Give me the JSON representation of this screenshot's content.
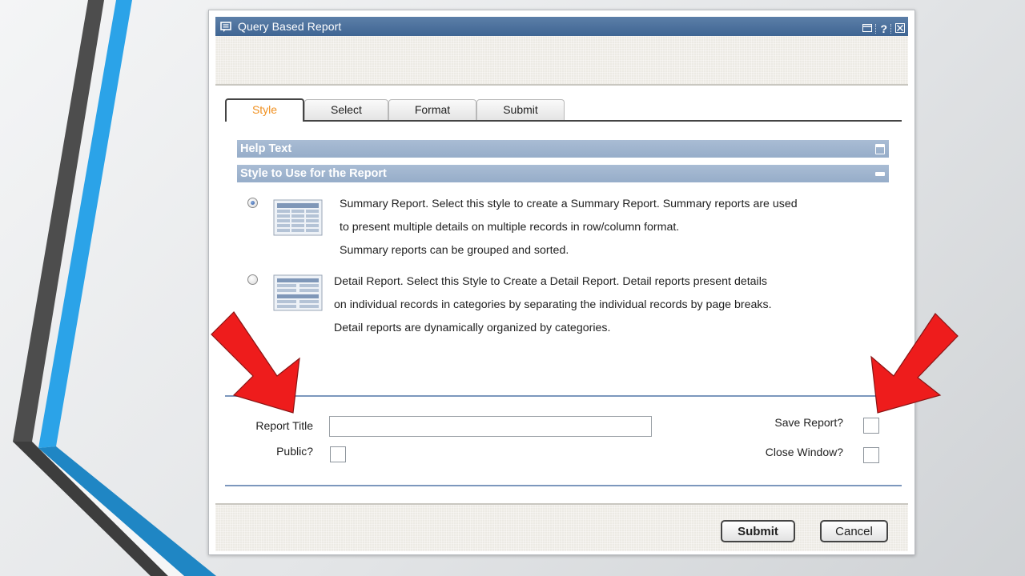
{
  "window": {
    "title": "Query Based Report",
    "help_glyph": "?"
  },
  "tabs": [
    {
      "label": "Style",
      "active": true
    },
    {
      "label": "Select",
      "active": false
    },
    {
      "label": "Format",
      "active": false
    },
    {
      "label": "Submit",
      "active": false
    }
  ],
  "sections": {
    "help_text": "Help Text",
    "style_to_use": "Style to Use for the Report"
  },
  "styles": [
    {
      "selected": true,
      "icon": "summary-report-icon",
      "lines": [
        "Summary Report. Select this style to create a Summary Report. Summary reports are used",
        "to present multiple details on multiple records in row/column format.",
        "Summary reports can be grouped and sorted."
      ]
    },
    {
      "selected": false,
      "icon": "detail-report-icon",
      "lines": [
        "Detail Report. Select this Style to Create a Detail Report. Detail reports present details",
        "on individual records in categories by separating the individual records by page breaks.",
        "Detail reports are dynamically organized by categories."
      ]
    }
  ],
  "form": {
    "report_title_label": "Report Title",
    "report_title_value": "",
    "public_label": "Public?",
    "public_checked": false,
    "save_report_label": "Save Report?",
    "save_report_checked": false,
    "close_window_label": "Close Window?",
    "close_window_checked": false
  },
  "buttons": {
    "submit": "Submit",
    "cancel": "Cancel"
  },
  "colors": {
    "title_bar": "#3f6593",
    "section_bar": "#9db2cc",
    "active_tab_text": "#f09020",
    "arrow": "#ff0000",
    "slide_blue": "#2aa3e6",
    "slide_dark": "#4a4a4a"
  }
}
